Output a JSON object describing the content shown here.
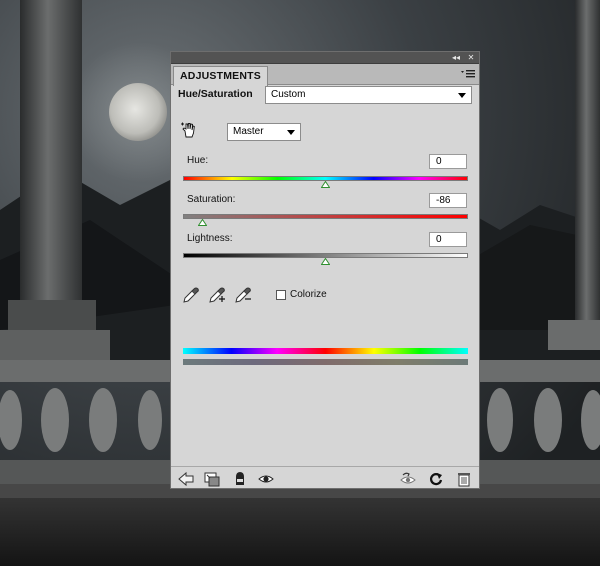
{
  "window": {
    "collapse_glyph": "◂◂",
    "close_glyph": "✕",
    "tab_label": "ADJUSTMENTS",
    "menu_icon": "panel-menu-icon"
  },
  "header": {
    "label": "Hue/Saturation",
    "preset_value": "Custom"
  },
  "channel": {
    "tool_icon": "targeted-adjustment-hand-icon",
    "value": "Master"
  },
  "sliders": {
    "hue": {
      "label": "Hue:",
      "value": "0",
      "position": 0.5
    },
    "saturation": {
      "label": "Saturation:",
      "value": "-86",
      "position": 0.07
    },
    "lightness": {
      "label": "Lightness:",
      "value": "0",
      "position": 0.5
    }
  },
  "eyedroppers": [
    "eyedropper-icon",
    "eyedropper-plus-icon",
    "eyedropper-minus-icon"
  ],
  "colorize": {
    "label": "Colorize",
    "checked": false
  },
  "footer_icons": {
    "left": [
      "back-arrow-icon",
      "clip-to-layer-icon",
      "visibility-mask-icon",
      "eye-icon"
    ],
    "right": [
      "view-previous-icon",
      "reset-icon",
      "trash-icon"
    ]
  },
  "colors": {
    "panel_bg": "#d6d6d6",
    "titlebar": "#535353",
    "thumb_green": "#2f8f2f"
  }
}
